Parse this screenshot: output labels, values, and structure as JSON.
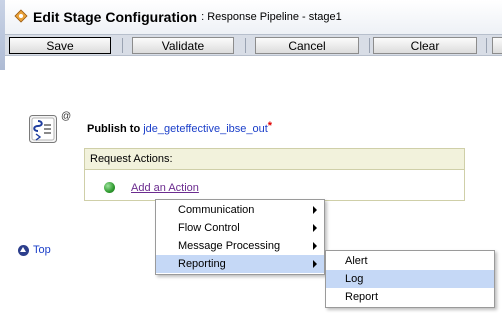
{
  "header": {
    "title": "Edit Stage Configuration",
    "subtitle": ": Response Pipeline - stage1"
  },
  "toolbar": {
    "save_label": "Save",
    "validate_label": "Validate",
    "cancel_label": "Cancel",
    "clear_label": "Clear"
  },
  "stage": {
    "annotation_mark": "@",
    "publish_label": "Publish to",
    "publish_target": "jde_geteffective_ibse_out",
    "required_mark": "*"
  },
  "request_actions": {
    "header": "Request Actions:",
    "add_action_label": "Add an Action"
  },
  "top_link": "Top",
  "context_menu": {
    "items": [
      {
        "label": "Communication",
        "submenu": true
      },
      {
        "label": "Flow Control",
        "submenu": true
      },
      {
        "label": "Message Processing",
        "submenu": true
      },
      {
        "label": "Reporting",
        "submenu": true,
        "highlighted": true
      }
    ]
  },
  "submenu": {
    "items": [
      {
        "label": "Alert"
      },
      {
        "label": "Log",
        "highlighted": true
      },
      {
        "label": "Report"
      }
    ]
  },
  "colors": {
    "link": "#1a3ec9",
    "visited_link": "#6b2b8f",
    "menu_highlight": "#c5d8f6",
    "panel_header": "#f2f2dc",
    "required": "#e00000"
  }
}
